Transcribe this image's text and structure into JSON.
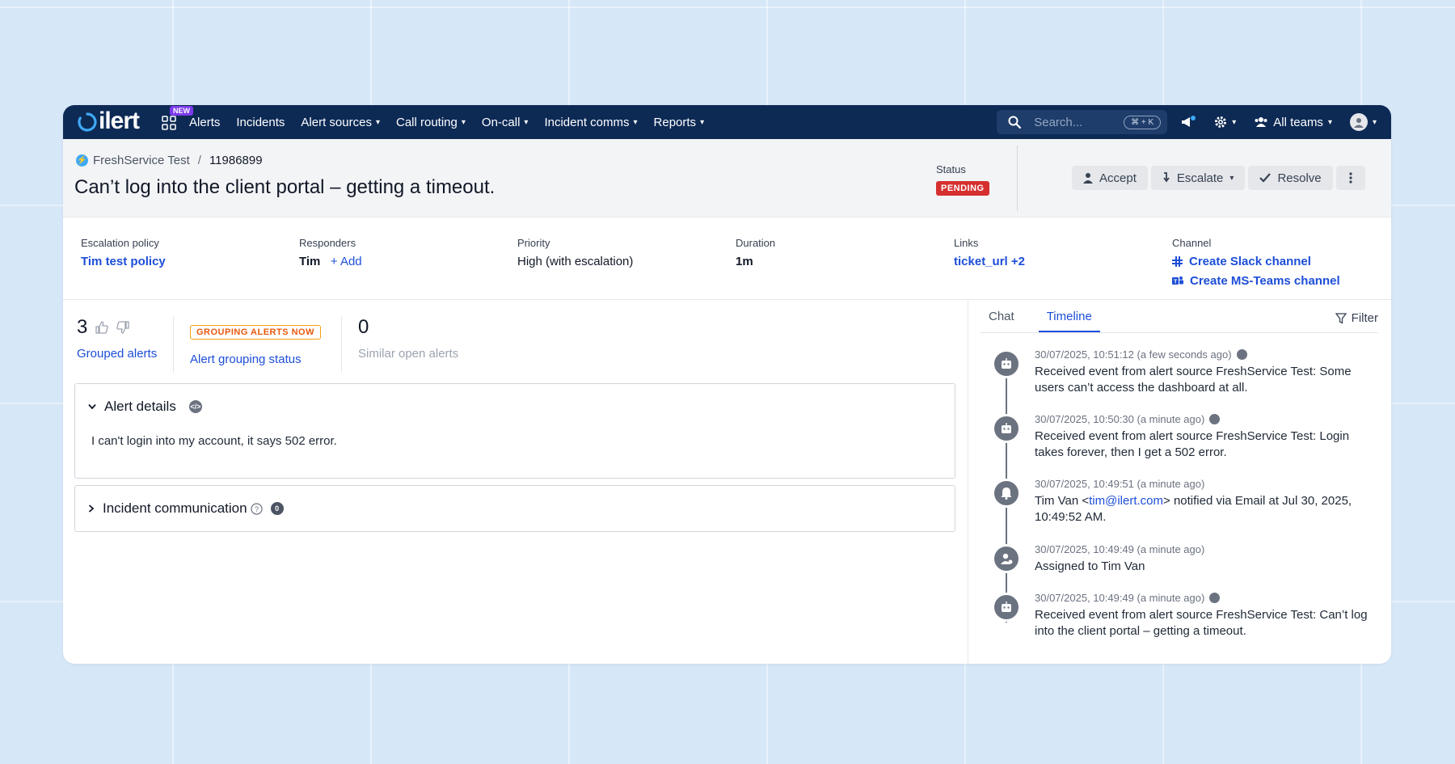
{
  "nav": {
    "logo_text": "ilert",
    "new_badge": "NEW",
    "items": [
      {
        "label": "Alerts",
        "has_chevron": false
      },
      {
        "label": "Incidents",
        "has_chevron": false
      },
      {
        "label": "Alert sources",
        "has_chevron": true
      },
      {
        "label": "Call routing",
        "has_chevron": true
      },
      {
        "label": "On-call",
        "has_chevron": true
      },
      {
        "label": "Incident comms",
        "has_chevron": true
      },
      {
        "label": "Reports",
        "has_chevron": true
      }
    ],
    "search_placeholder": "Search...",
    "search_shortcut": "⌘ + K",
    "teams_label": "All teams"
  },
  "header": {
    "breadcrumb_source": "FreshService Test",
    "breadcrumb_separator": "/",
    "breadcrumb_id": "11986899",
    "title": "Can’t log into the client portal – getting a timeout.",
    "status_label": "Status",
    "status_value": "PENDING",
    "actions": {
      "accept": "Accept",
      "escalate": "Escalate",
      "resolve": "Resolve"
    }
  },
  "info": {
    "escalation_policy": {
      "label": "Escalation policy",
      "value": "Tim test policy"
    },
    "responders": {
      "label": "Responders",
      "value": "Tim",
      "add": "+ Add"
    },
    "priority": {
      "label": "Priority",
      "value": "High (with escalation)"
    },
    "duration": {
      "label": "Duration",
      "value": "1m"
    },
    "links": {
      "label": "Links",
      "value": "ticket_url +2"
    },
    "channel": {
      "label": "Channel",
      "slack": "Create Slack channel",
      "teams": "Create MS-Teams channel"
    }
  },
  "stats": {
    "grouped_count": "3",
    "grouped_label": "Grouped alerts",
    "grouping_badge": "GROUPING ALERTS NOW",
    "grouping_label": "Alert grouping status",
    "similar_count": "0",
    "similar_label": "Similar open alerts"
  },
  "alert_details": {
    "title": "Alert details",
    "body": "I can't login into my account, it says 502 error."
  },
  "incident_comm": {
    "title": "Incident communication",
    "count": "0"
  },
  "right": {
    "tabs": [
      "Chat",
      "Timeline"
    ],
    "active_tab": "Timeline",
    "filter_label": "Filter",
    "timeline": [
      {
        "icon": "robot-icon",
        "time": "30/07/2025, 10:51:12 (a few seconds ago)",
        "show_badge": true,
        "msg": "Received event from alert source FreshService Test: Some users can’t access the dashboard at all."
      },
      {
        "icon": "robot-icon",
        "time": "30/07/2025, 10:50:30 (a minute ago)",
        "show_badge": true,
        "msg": "Received event from alert source FreshService Test: Login takes forever, then I get a 502 error."
      },
      {
        "icon": "bell-icon",
        "time": "30/07/2025, 10:49:51 (a minute ago)",
        "show_badge": false,
        "msg_pre": "Tim Van <",
        "msg_link": "tim@ilert.com",
        "msg_post": "> notified via Email at Jul 30, 2025, 10:49:52 AM."
      },
      {
        "icon": "user-assign-icon",
        "time": "30/07/2025, 10:49:49 (a minute ago)",
        "show_badge": false,
        "msg": "Assigned to Tim Van"
      },
      {
        "icon": "robot-icon",
        "time": "30/07/2025, 10:49:49 (a minute ago)",
        "show_badge": true,
        "msg": "Received event from alert source FreshService Test: Can’t log into the client portal – getting a timeout."
      }
    ]
  },
  "colors": {
    "nav_bg": "#0d2a55",
    "link": "#1d4ed8",
    "pending": "#d62f2f",
    "grouping": "#ea580c",
    "new_badge": "#7c3aed"
  }
}
